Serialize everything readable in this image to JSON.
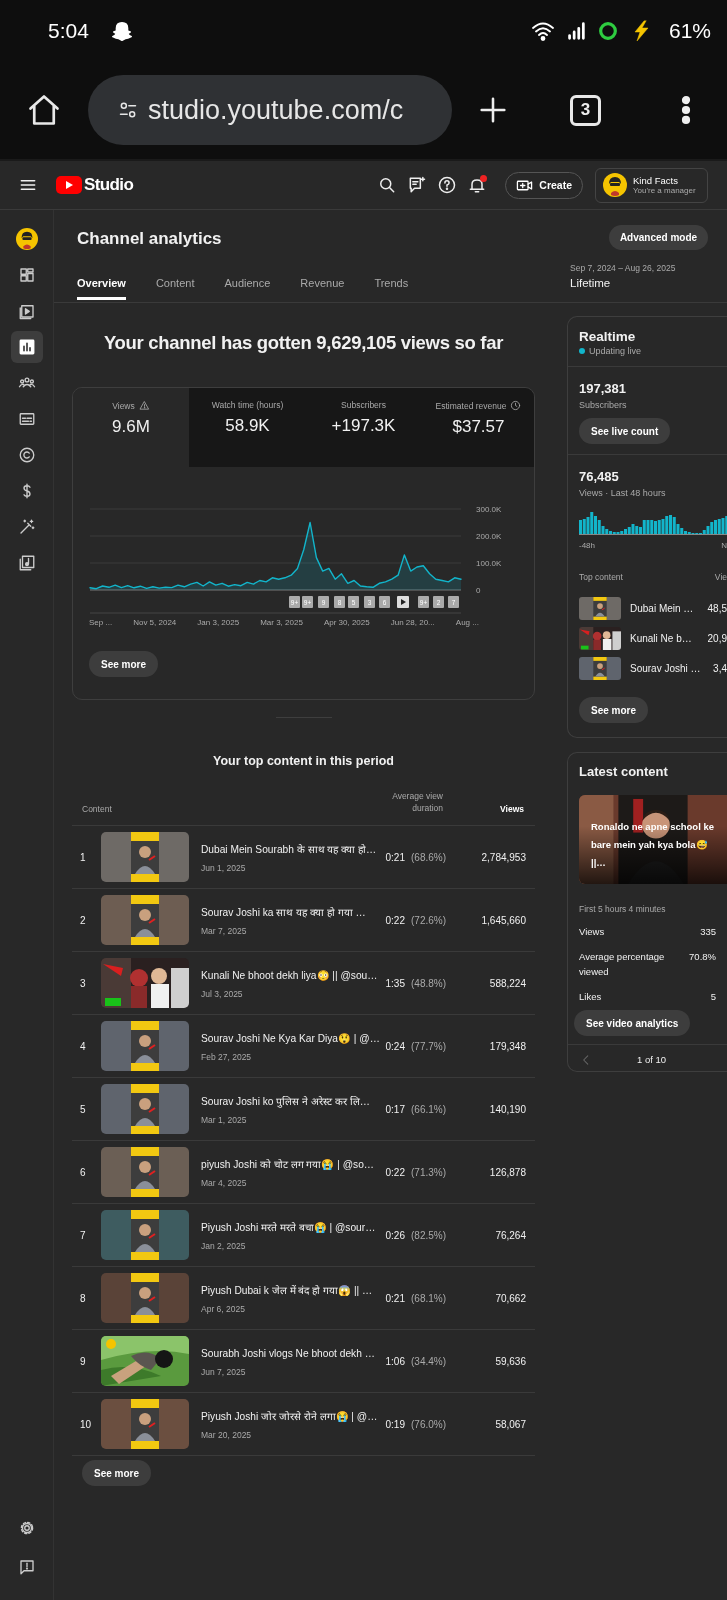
{
  "status_bar": {
    "time": "5:04",
    "battery": "61%"
  },
  "browser": {
    "url": "studio.youtube.com/c",
    "tab_count": "3"
  },
  "header": {
    "logo": "Studio",
    "create": "Create",
    "account": {
      "name": "Kind Facts",
      "role": "You're a manager"
    }
  },
  "sidebar": {
    "items": [
      {
        "kind": "avatar",
        "selected": false
      },
      {
        "kind": "dashboard",
        "selected": false
      },
      {
        "kind": "content",
        "selected": false
      },
      {
        "kind": "analytics",
        "selected": true
      },
      {
        "kind": "community",
        "selected": false
      },
      {
        "kind": "subtitles",
        "selected": false
      },
      {
        "kind": "copyright",
        "selected": false
      },
      {
        "kind": "earn",
        "selected": false
      },
      {
        "kind": "customization",
        "selected": false
      },
      {
        "kind": "audio",
        "selected": false
      }
    ],
    "footer_items": [
      {
        "kind": "settings",
        "selected": false
      },
      {
        "kind": "feedback",
        "selected": false
      }
    ]
  },
  "page": {
    "title": "Channel analytics",
    "advanced_button": "Advanced mode",
    "date_range": "Sep 7, 2024 – Aug 26, 2025",
    "period": "Lifetime"
  },
  "tabs": [
    {
      "label": "Overview",
      "selected": true
    },
    {
      "label": "Content",
      "selected": false
    },
    {
      "label": "Audience",
      "selected": false
    },
    {
      "label": "Revenue",
      "selected": false
    },
    {
      "label": "Trends",
      "selected": false
    }
  ],
  "headline": "Your channel has gotten 9,629,105 views so far",
  "metrics": [
    {
      "kind": "warning",
      "label": "Views",
      "value": "9.6M",
      "selected": true
    },
    {
      "kind": "plain",
      "label": "Watch time (hours)",
      "value": "58.9K",
      "selected": false
    },
    {
      "kind": "plain",
      "label": "Subscribers",
      "value": "+197.3K",
      "selected": false
    },
    {
      "kind": "clock",
      "label": "Estimated revenue",
      "value": "$37.57",
      "selected": false
    }
  ],
  "chart": {
    "chart_data": {
      "type": "area",
      "ylim": [
        0,
        300000
      ],
      "yticks": [
        {
          "value": 0,
          "label": "0"
        },
        {
          "value": 100000,
          "label": "100.0K"
        },
        {
          "value": 200000,
          "label": "200.0K"
        },
        {
          "value": 300000,
          "label": "300.0K"
        }
      ],
      "series": [
        {
          "color": "#12b5cb",
          "values": [
            8000,
            5000,
            15000,
            10000,
            18000,
            9000,
            16000,
            8000,
            14000,
            6000,
            12000,
            7000,
            10000,
            9000,
            18000,
            12000,
            22000,
            28000,
            15000,
            30000,
            18000,
            25000,
            14000,
            20000,
            16000,
            28000,
            22000,
            35000,
            30000,
            45000,
            40000,
            45000,
            55000,
            80000,
            150000,
            250000,
            120000,
            70000,
            80000,
            40000,
            60000,
            25000,
            35000,
            15000,
            12000,
            10000,
            25000,
            30000,
            40000,
            55000,
            130000,
            70000,
            85000,
            90000,
            60000,
            40000,
            35000,
            30000,
            45000,
            40000
          ]
        }
      ]
    },
    "x_labels": [
      "Sep ...",
      "Nov 5, 2024",
      "Jan 3, 2025",
      "Mar 3, 2025",
      "Apr 30, 2025",
      "Jun 28, 20...",
      "Aug ..."
    ],
    "markers": [
      {
        "kind": "count",
        "label": "9+"
      },
      {
        "kind": "count",
        "label": "9+"
      },
      {
        "kind": "count",
        "label": "9"
      },
      {
        "kind": "count",
        "label": "8"
      },
      {
        "kind": "count",
        "label": "5"
      },
      {
        "kind": "count",
        "label": "3"
      },
      {
        "kind": "count",
        "label": "6"
      },
      {
        "kind": "play"
      },
      {
        "kind": "count",
        "label": "9+"
      },
      {
        "kind": "count",
        "label": "2"
      },
      {
        "kind": "count",
        "label": "7"
      }
    ],
    "see_more": "See more"
  },
  "top_content": {
    "title": "Your top content in this period",
    "columns": [
      "Content",
      "Average view duration",
      "Views"
    ],
    "rows": [
      {
        "rank": "1",
        "title": "Dubai Mein Sourabh के साथ यह क्या हो…",
        "date": "Jun 1, 2025",
        "duration": "0:21",
        "percent": "(68.6%)",
        "views": "2,784,953"
      },
      {
        "rank": "2",
        "title": "Sourav Joshi ka साथ यह क्या हो गया …",
        "date": "Mar 7, 2025",
        "duration": "0:22",
        "percent": "(72.6%)",
        "views": "1,645,660"
      },
      {
        "rank": "3",
        "title": "Kunali Ne bhoot dekh liya😳 || @sou…",
        "date": "Jul 3, 2025",
        "duration": "1:35",
        "percent": "(48.8%)",
        "views": "588,224"
      },
      {
        "rank": "4",
        "title": "Sourav Joshi Ne Kya Kar Diya😲 | @…",
        "date": "Feb 27, 2025",
        "duration": "0:24",
        "percent": "(77.7%)",
        "views": "179,348"
      },
      {
        "rank": "5",
        "title": "Sourav Joshi ko पुलिस ने अरेस्ट कर लि…",
        "date": "Mar 1, 2025",
        "duration": "0:17",
        "percent": "(66.1%)",
        "views": "140,190"
      },
      {
        "rank": "6",
        "title": "piyush Joshi को चोट लग गया😭 | @so…",
        "date": "Mar 4, 2025",
        "duration": "0:22",
        "percent": "(71.3%)",
        "views": "126,878"
      },
      {
        "rank": "7",
        "title": "Piyush Joshi मरते मरते बचा😭 | @sour…",
        "date": "Jan 2, 2025",
        "duration": "0:26",
        "percent": "(82.5%)",
        "views": "76,264"
      },
      {
        "rank": "8",
        "title": "Piyush Dubai k जेल में बंद हो गया😱 || …",
        "date": "Apr 6, 2025",
        "duration": "0:21",
        "percent": "(68.1%)",
        "views": "70,662"
      },
      {
        "rank": "9",
        "title": "Sourabh Joshi vlogs Ne bhoot dekh …",
        "date": "Jun 7, 2025",
        "duration": "1:06",
        "percent": "(34.4%)",
        "views": "59,636"
      },
      {
        "rank": "10",
        "title": "Piyush Joshi जोर जोरसे रोने लगा😭 | @…",
        "date": "Mar 20, 2025",
        "duration": "0:19",
        "percent": "(76.0%)",
        "views": "58,067"
      }
    ],
    "see_more": "See more"
  },
  "realtime": {
    "title": "Realtime",
    "live": "Updating live",
    "subscribers": {
      "value": "197,381",
      "label": "Subscribers"
    },
    "live_button": "See live count",
    "views": {
      "value": "76,485",
      "label": "Views · Last 48 hours"
    },
    "axis_start": "-48h",
    "axis_end": "N",
    "top_label": "Top content",
    "views_label": "Vie",
    "items": [
      {
        "title": "Dubai Mein …",
        "views": "48,5"
      },
      {
        "title": "Kunali Ne b…",
        "views": "20,9"
      },
      {
        "title": "Sourav Joshi …",
        "views": "3,4"
      }
    ],
    "see_more": "See more"
  },
  "latest": {
    "title": "Latest content",
    "caption": "Ronaldo ne apne school ke bare mein yah kya bola😅 ||…",
    "period": "First 5 hours 4 minutes",
    "stats": [
      {
        "label": "Views",
        "value": "335"
      },
      {
        "label": "Average percentage viewed",
        "value": "70.8%"
      },
      {
        "label": "Likes",
        "value": "5"
      }
    ],
    "button": "See video analytics",
    "pager": "1 of 10"
  }
}
